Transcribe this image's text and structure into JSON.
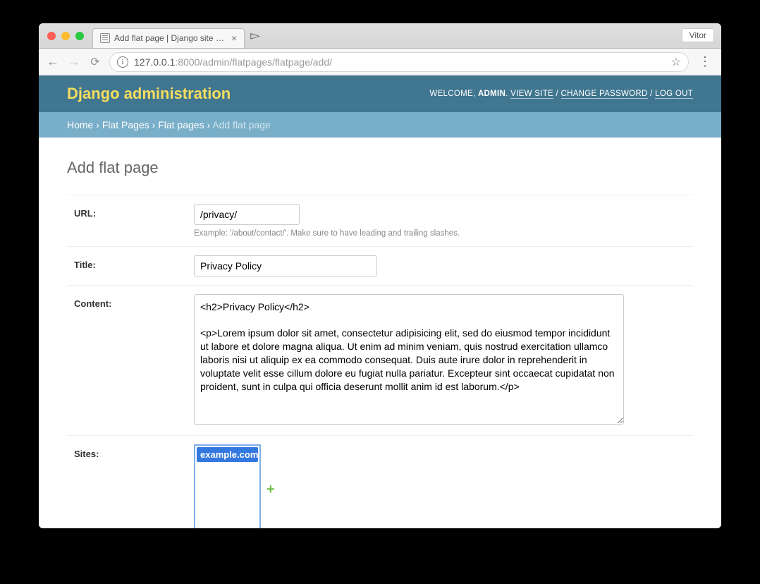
{
  "browser": {
    "tab_title": "Add flat page | Django site adm",
    "profile_name": "Vitor",
    "url_host": "127.0.0.1",
    "url_port_path": ":8000/admin/flatpages/flatpage/add/"
  },
  "header": {
    "brand": "Django administration",
    "welcome": "WELCOME,",
    "username": "ADMIN",
    "view_site": "VIEW SITE",
    "change_password": "CHANGE PASSWORD",
    "logout": "LOG OUT"
  },
  "breadcrumbs": {
    "home": "Home",
    "app": "Flat Pages",
    "model": "Flat pages",
    "current": "Add flat page"
  },
  "page_title": "Add flat page",
  "form": {
    "url_label": "URL:",
    "url_value": "/privacy/",
    "url_help": "Example: '/about/contact/'. Make sure to have leading and trailing slashes.",
    "title_label": "Title:",
    "title_value": "Privacy Policy",
    "content_label": "Content:",
    "content_value": "<h2>Privacy Policy</h2>\n\n<p>Lorem ipsum dolor sit amet, consectetur adipisicing elit, sed do eiusmod tempor incididunt ut labore et dolore magna aliqua. Ut enim ad minim veniam, quis nostrud exercitation ullamco laboris nisi ut aliquip ex ea commodo consequat. Duis aute irure dolor in reprehenderit in voluptate velit esse cillum dolore eu fugiat nulla pariatur. Excepteur sint occaecat cupidatat non proident, sunt in culpa qui officia deserunt mollit anim id est laborum.</p>",
    "sites_label": "Sites:",
    "sites_options": [
      "example.com"
    ]
  }
}
